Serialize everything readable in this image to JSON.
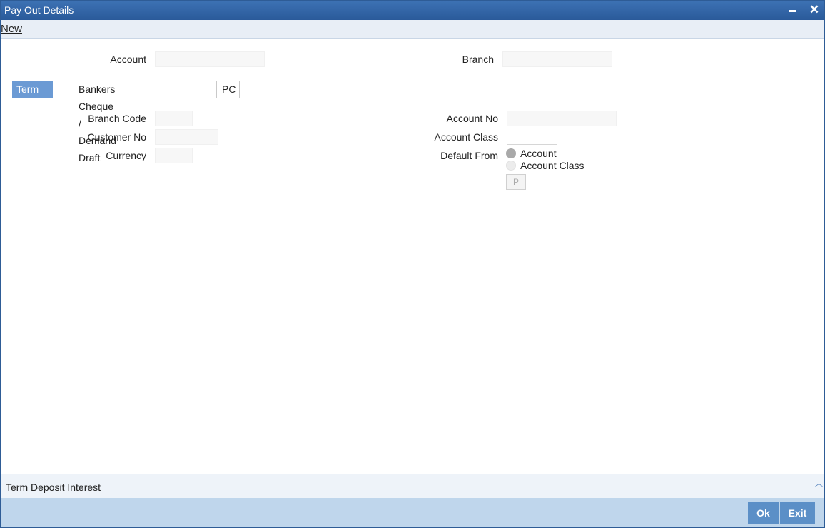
{
  "window": {
    "title": "Pay Out Details"
  },
  "toolbar": {
    "new_label": "New"
  },
  "header_fields": {
    "account_label": "Account",
    "account_value": "",
    "branch_label": "Branch",
    "branch_value": ""
  },
  "tabs": [
    {
      "label": "Term deposit",
      "active": true
    },
    {
      "label": "Bankers Cheque / Demand Draft",
      "active": false
    },
    {
      "label": "PC",
      "active": false
    }
  ],
  "term_deposit": {
    "branch_code_label": "Branch Code",
    "branch_code_value": "",
    "customer_no_label": "Customer No",
    "customer_no_value": "",
    "currency_label": "Currency",
    "currency_value": "",
    "account_no_label": "Account No",
    "account_no_value": "",
    "account_class_label": "Account Class",
    "account_class_value": "",
    "default_from_label": "Default From",
    "default_from_options": [
      {
        "label": "Account",
        "selected": true
      },
      {
        "label": "Account Class",
        "selected": false
      }
    ],
    "p_button_label": "P"
  },
  "bottom_section": {
    "label": "Term Deposit Interest",
    "icon": "chevron-up-icon"
  },
  "footer": {
    "ok_label": "Ok",
    "exit_label": "Exit"
  },
  "colors": {
    "titlebar": "#2e5c96",
    "active_tab": "#6b9ad4",
    "footer": "#bfd6ec",
    "footer_button": "#5b8fc7"
  }
}
